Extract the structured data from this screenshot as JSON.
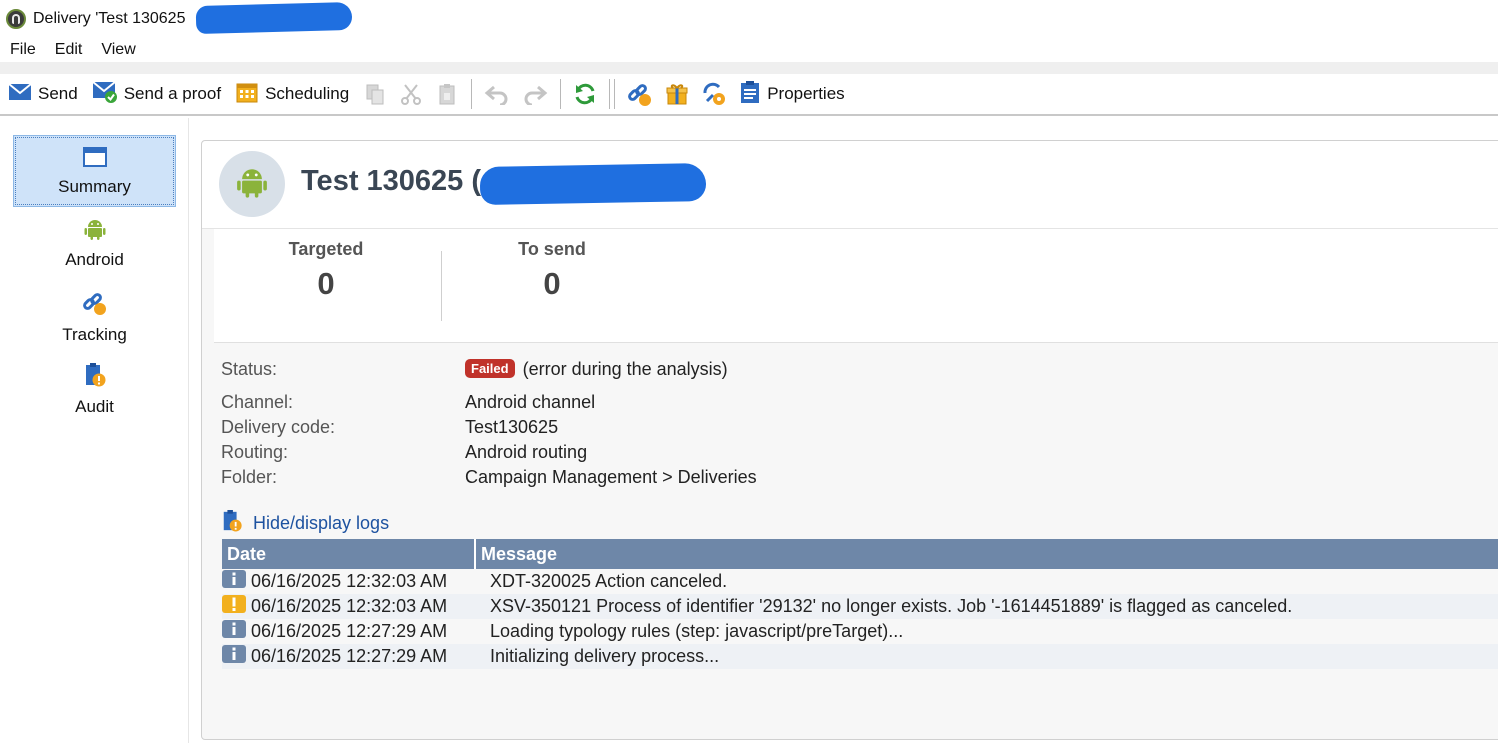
{
  "window": {
    "title": "Delivery 'Test 130625"
  },
  "menu": {
    "items": [
      "File",
      "Edit",
      "View"
    ]
  },
  "toolbar": {
    "send": "Send",
    "send_proof": "Send a proof",
    "scheduling": "Scheduling",
    "properties": "Properties"
  },
  "sidebar": {
    "items": [
      {
        "label": "Summary",
        "icon": "window-icon"
      },
      {
        "label": "Android",
        "icon": "android-icon"
      },
      {
        "label": "Tracking",
        "icon": "tracking-link-icon"
      },
      {
        "label": "Audit",
        "icon": "audit-icon"
      }
    ]
  },
  "header": {
    "title": "Test 130625 (",
    "title_close": ")"
  },
  "stats": {
    "targeted_label": "Targeted",
    "targeted_value": "0",
    "tosend_label": "To send",
    "tosend_value": "0"
  },
  "details": {
    "status_label": "Status:",
    "status_badge": "Failed",
    "status_text": "(error during the analysis)",
    "channel_label": "Channel:",
    "channel_value": "Android channel",
    "code_label": "Delivery code:",
    "code_value": "Test130625",
    "routing_label": "Routing:",
    "routing_value": "Android routing",
    "folder_label": "Folder:",
    "folder_value": "Campaign Management > Deliveries"
  },
  "logs": {
    "toggle_label": "Hide/display logs",
    "columns": {
      "date": "Date",
      "message": "Message"
    },
    "rows": [
      {
        "level": "info",
        "date": "06/16/2025 12:32:03 AM",
        "message": "XDT-320025 Action canceled."
      },
      {
        "level": "warning",
        "date": "06/16/2025 12:32:03 AM",
        "message": "XSV-350121 Process of identifier '29132' no longer exists. Job '-1614451889' is flagged as canceled."
      },
      {
        "level": "info",
        "date": "06/16/2025 12:27:29 AM",
        "message": "Loading typology rules (step: javascript/preTarget)..."
      },
      {
        "level": "info",
        "date": "06/16/2025 12:27:29 AM",
        "message": "Initializing delivery process..."
      }
    ]
  },
  "colors": {
    "accent": "#1d52a0",
    "table_header": "#6e87a8",
    "failed_badge": "#c0322a",
    "android_green": "#8bb33b",
    "redaction": "#1f6fe0"
  }
}
